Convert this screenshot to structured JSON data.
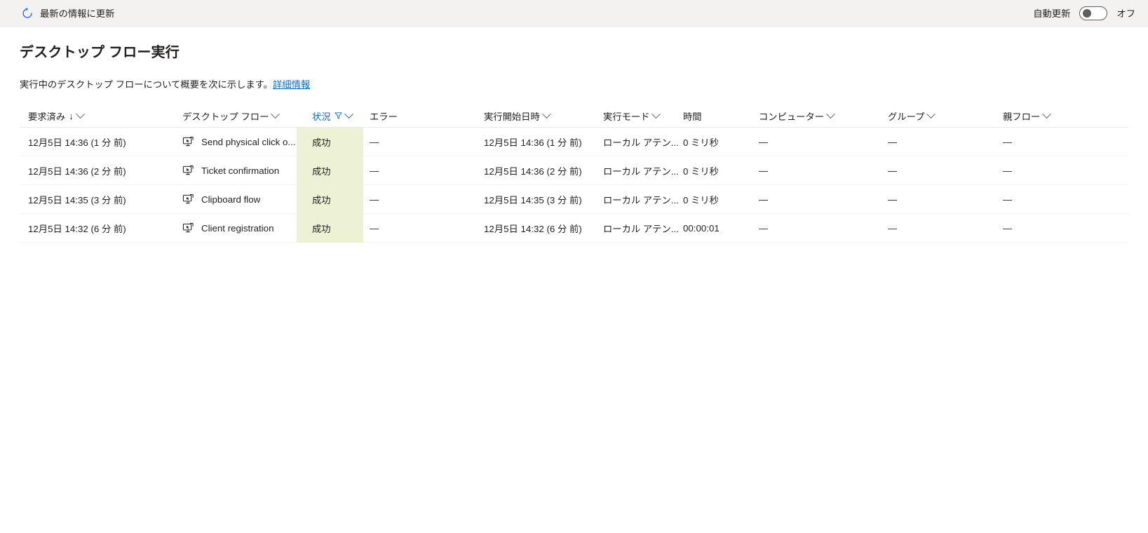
{
  "command_bar": {
    "refresh_label": "最新の情報に更新",
    "refresh_icon": "refresh-icon",
    "auto_refresh_label": "自動更新",
    "toggle_state_label": "オフ",
    "toggle_on": false
  },
  "page": {
    "title": "デスクトップ フロー実行",
    "description": "実行中のデスクトップ フローについて概要を次に示します。",
    "learn_more_link": "詳細情報"
  },
  "grid": {
    "columns": [
      {
        "key": "requested",
        "label": "要求済み",
        "sorted": true,
        "sort_glyph": "↓",
        "has_menu": true,
        "filtered": false
      },
      {
        "key": "flow",
        "label": "デスクトップ フロー",
        "sorted": false,
        "sort_glyph": "",
        "has_menu": true,
        "filtered": false
      },
      {
        "key": "status",
        "label": "状況",
        "sorted": false,
        "sort_glyph": "",
        "has_menu": true,
        "filtered": true
      },
      {
        "key": "error",
        "label": "エラー",
        "sorted": false,
        "sort_glyph": "",
        "has_menu": false,
        "filtered": false
      },
      {
        "key": "start",
        "label": "実行開始日時",
        "sorted": false,
        "sort_glyph": "",
        "has_menu": true,
        "filtered": false
      },
      {
        "key": "mode",
        "label": "実行モード",
        "sorted": false,
        "sort_glyph": "",
        "has_menu": true,
        "filtered": false
      },
      {
        "key": "duration",
        "label": "時間",
        "sorted": false,
        "sort_glyph": "",
        "has_menu": false,
        "filtered": false
      },
      {
        "key": "computer",
        "label": "コンピューター",
        "sorted": false,
        "sort_glyph": "",
        "has_menu": true,
        "filtered": false
      },
      {
        "key": "group",
        "label": "グループ",
        "sorted": false,
        "sort_glyph": "",
        "has_menu": true,
        "filtered": false
      },
      {
        "key": "parent",
        "label": "親フロー",
        "sorted": false,
        "sort_glyph": "",
        "has_menu": true,
        "filtered": false
      }
    ],
    "status_highlight_color": "#edf2d4",
    "flow_icon": "desktop-flow-icon",
    "rows": [
      {
        "requested": "12月5日 14:36 (1 分 前)",
        "flow": "Send physical click o...",
        "status": "成功",
        "error": "—",
        "start": "12月5日 14:36 (1 分 前)",
        "mode": "ローカル アテン...",
        "duration": "0 ミリ秒",
        "computer": "—",
        "group": "—",
        "parent": "—"
      },
      {
        "requested": "12月5日 14:36 (2 分 前)",
        "flow": "Ticket confirmation",
        "status": "成功",
        "error": "—",
        "start": "12月5日 14:36 (2 分 前)",
        "mode": "ローカル アテン...",
        "duration": "0 ミリ秒",
        "computer": "—",
        "group": "—",
        "parent": "—"
      },
      {
        "requested": "12月5日 14:35 (3 分 前)",
        "flow": "Clipboard flow",
        "status": "成功",
        "error": "—",
        "start": "12月5日 14:35 (3 分 前)",
        "mode": "ローカル アテン...",
        "duration": "0 ミリ秒",
        "computer": "—",
        "group": "—",
        "parent": "—"
      },
      {
        "requested": "12月5日 14:32 (6 分 前)",
        "flow": "Client registration",
        "status": "成功",
        "error": "—",
        "start": "12月5日 14:32 (6 分 前)",
        "mode": "ローカル アテン...",
        "duration": "00:00:01",
        "computer": "—",
        "group": "—",
        "parent": "—"
      }
    ]
  },
  "colors": {
    "accent": "#0f6cbd",
    "command_bar_bg": "#f3f2f1",
    "status_bg": "#edf2d4",
    "text": "#201f1e"
  }
}
